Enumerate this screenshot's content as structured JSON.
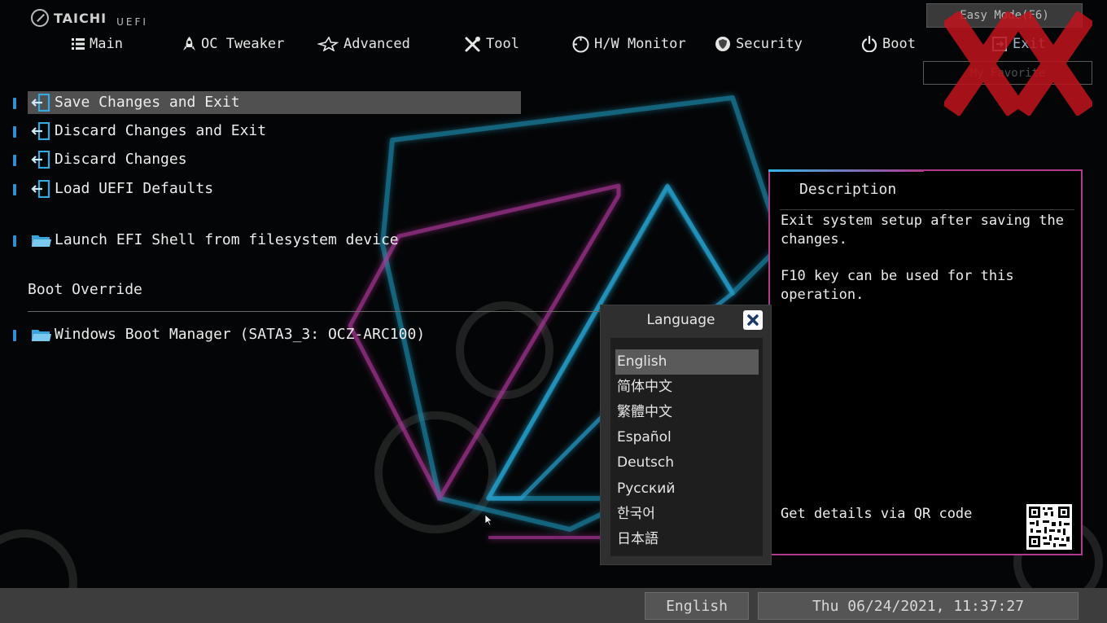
{
  "brand": {
    "name": "TAICHI",
    "sub": "UEFI"
  },
  "nav": {
    "tabs": [
      {
        "label": "Main",
        "icon": "list-icon"
      },
      {
        "label": "OC Tweaker",
        "icon": "rocket-icon"
      },
      {
        "label": "Advanced",
        "icon": "star-icon"
      },
      {
        "label": "Tool",
        "icon": "tools-icon"
      },
      {
        "label": "H/W Monitor",
        "icon": "monitor-icon"
      },
      {
        "label": "Security",
        "icon": "shield-icon"
      },
      {
        "label": "Boot",
        "icon": "power-icon"
      },
      {
        "label": "Exit",
        "icon": "exit-icon",
        "active": true
      }
    ],
    "easy_mode": "Easy Mode(F6)",
    "my_favorite": "My Favorite"
  },
  "menu": {
    "items": [
      {
        "label": "Save Changes and Exit",
        "icon": "exit-door-icon",
        "selected": true
      },
      {
        "label": "Discard Changes and Exit",
        "icon": "exit-door-icon"
      },
      {
        "label": "Discard Changes",
        "icon": "exit-door-icon"
      },
      {
        "label": "Load UEFI Defaults",
        "icon": "exit-door-icon"
      },
      {
        "label": "Launch EFI Shell from filesystem device",
        "icon": "folder-icon"
      }
    ],
    "boot_override_title": "Boot Override",
    "boot_items": [
      {
        "label": "Windows Boot Manager (SATA3_3: OCZ-ARC100)",
        "icon": "folder-icon"
      }
    ]
  },
  "description": {
    "title": "Description",
    "line1": "Exit system setup after saving the changes.",
    "line2": "F10 key can be used for this operation.",
    "qr_label": "Get details via QR code"
  },
  "language_popup": {
    "title": "Language",
    "options": [
      "English",
      "简体中文",
      "繁體中文",
      "Español",
      "Deutsch",
      "Русский",
      "한국어",
      "日本語"
    ],
    "selected": "English"
  },
  "footer": {
    "language": "English",
    "datetime": "Thu 06/24/2021, 11:37:27"
  },
  "colors": {
    "accent_cyan": "#35b6e6",
    "accent_magenta": "#b03a8e",
    "bullet_blue": "#2f8fd0",
    "watermark_red": "#c0141c"
  }
}
